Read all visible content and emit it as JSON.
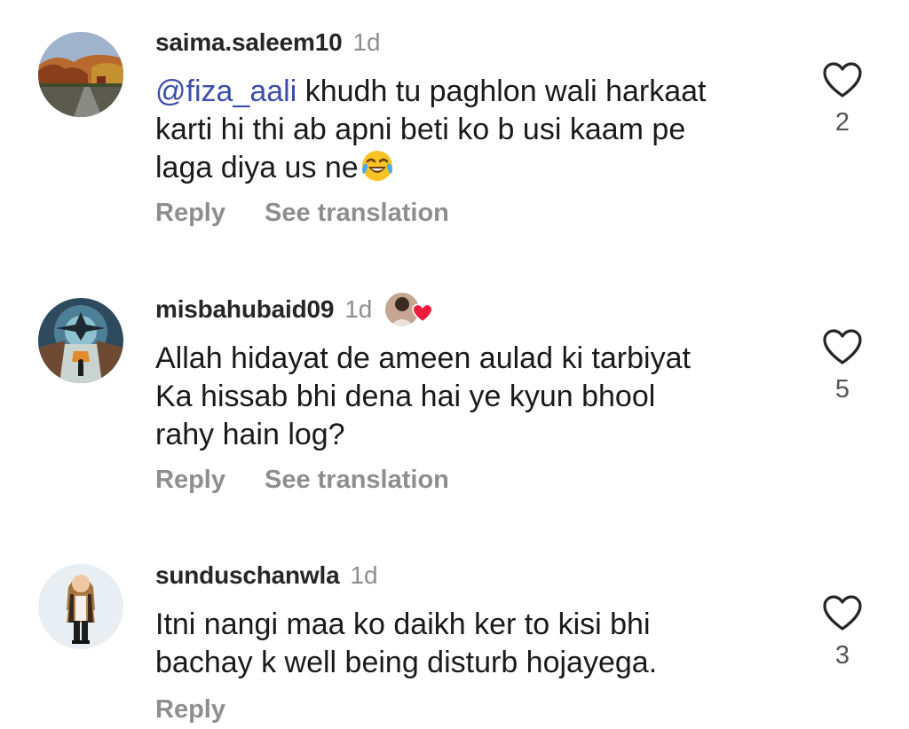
{
  "comments": [
    {
      "username": "saima.saleem10",
      "time": "1d",
      "mention": "@fiza_aali",
      "text": " khudh tu paghlon wali harkaat\nkarti hi thi ab apni beti ko b usi kaam pe\nlaga diya us ne",
      "emoji": "face-with-tears-of-joy",
      "likes": "2",
      "reply_label": "Reply",
      "translate_label": "See translation"
    },
    {
      "username": "misbahubaid09",
      "time": "1d",
      "text": "Allah hidayat de ameen aulad ki tarbiyat\nKa hissab bhi dena hai ye kyun bhool\nrahy hain log?",
      "likes": "5",
      "reply_label": "Reply",
      "translate_label": "See translation"
    },
    {
      "username": "sunduschanwla",
      "time": "1d",
      "text": "Itni nangi maa ko daikh ker to kisi bhi\nbachay k well being disturb hojayega.",
      "likes": "3",
      "reply_label": "Reply"
    }
  ],
  "colors": {
    "mention": "#3b4fa8",
    "secondary_text": "#8e8e8e",
    "heart_outline": "#262626",
    "reaction_heart": "#ed1c3b"
  },
  "icons": {
    "like": "heart-outline-icon",
    "reaction": "red-heart-icon"
  }
}
